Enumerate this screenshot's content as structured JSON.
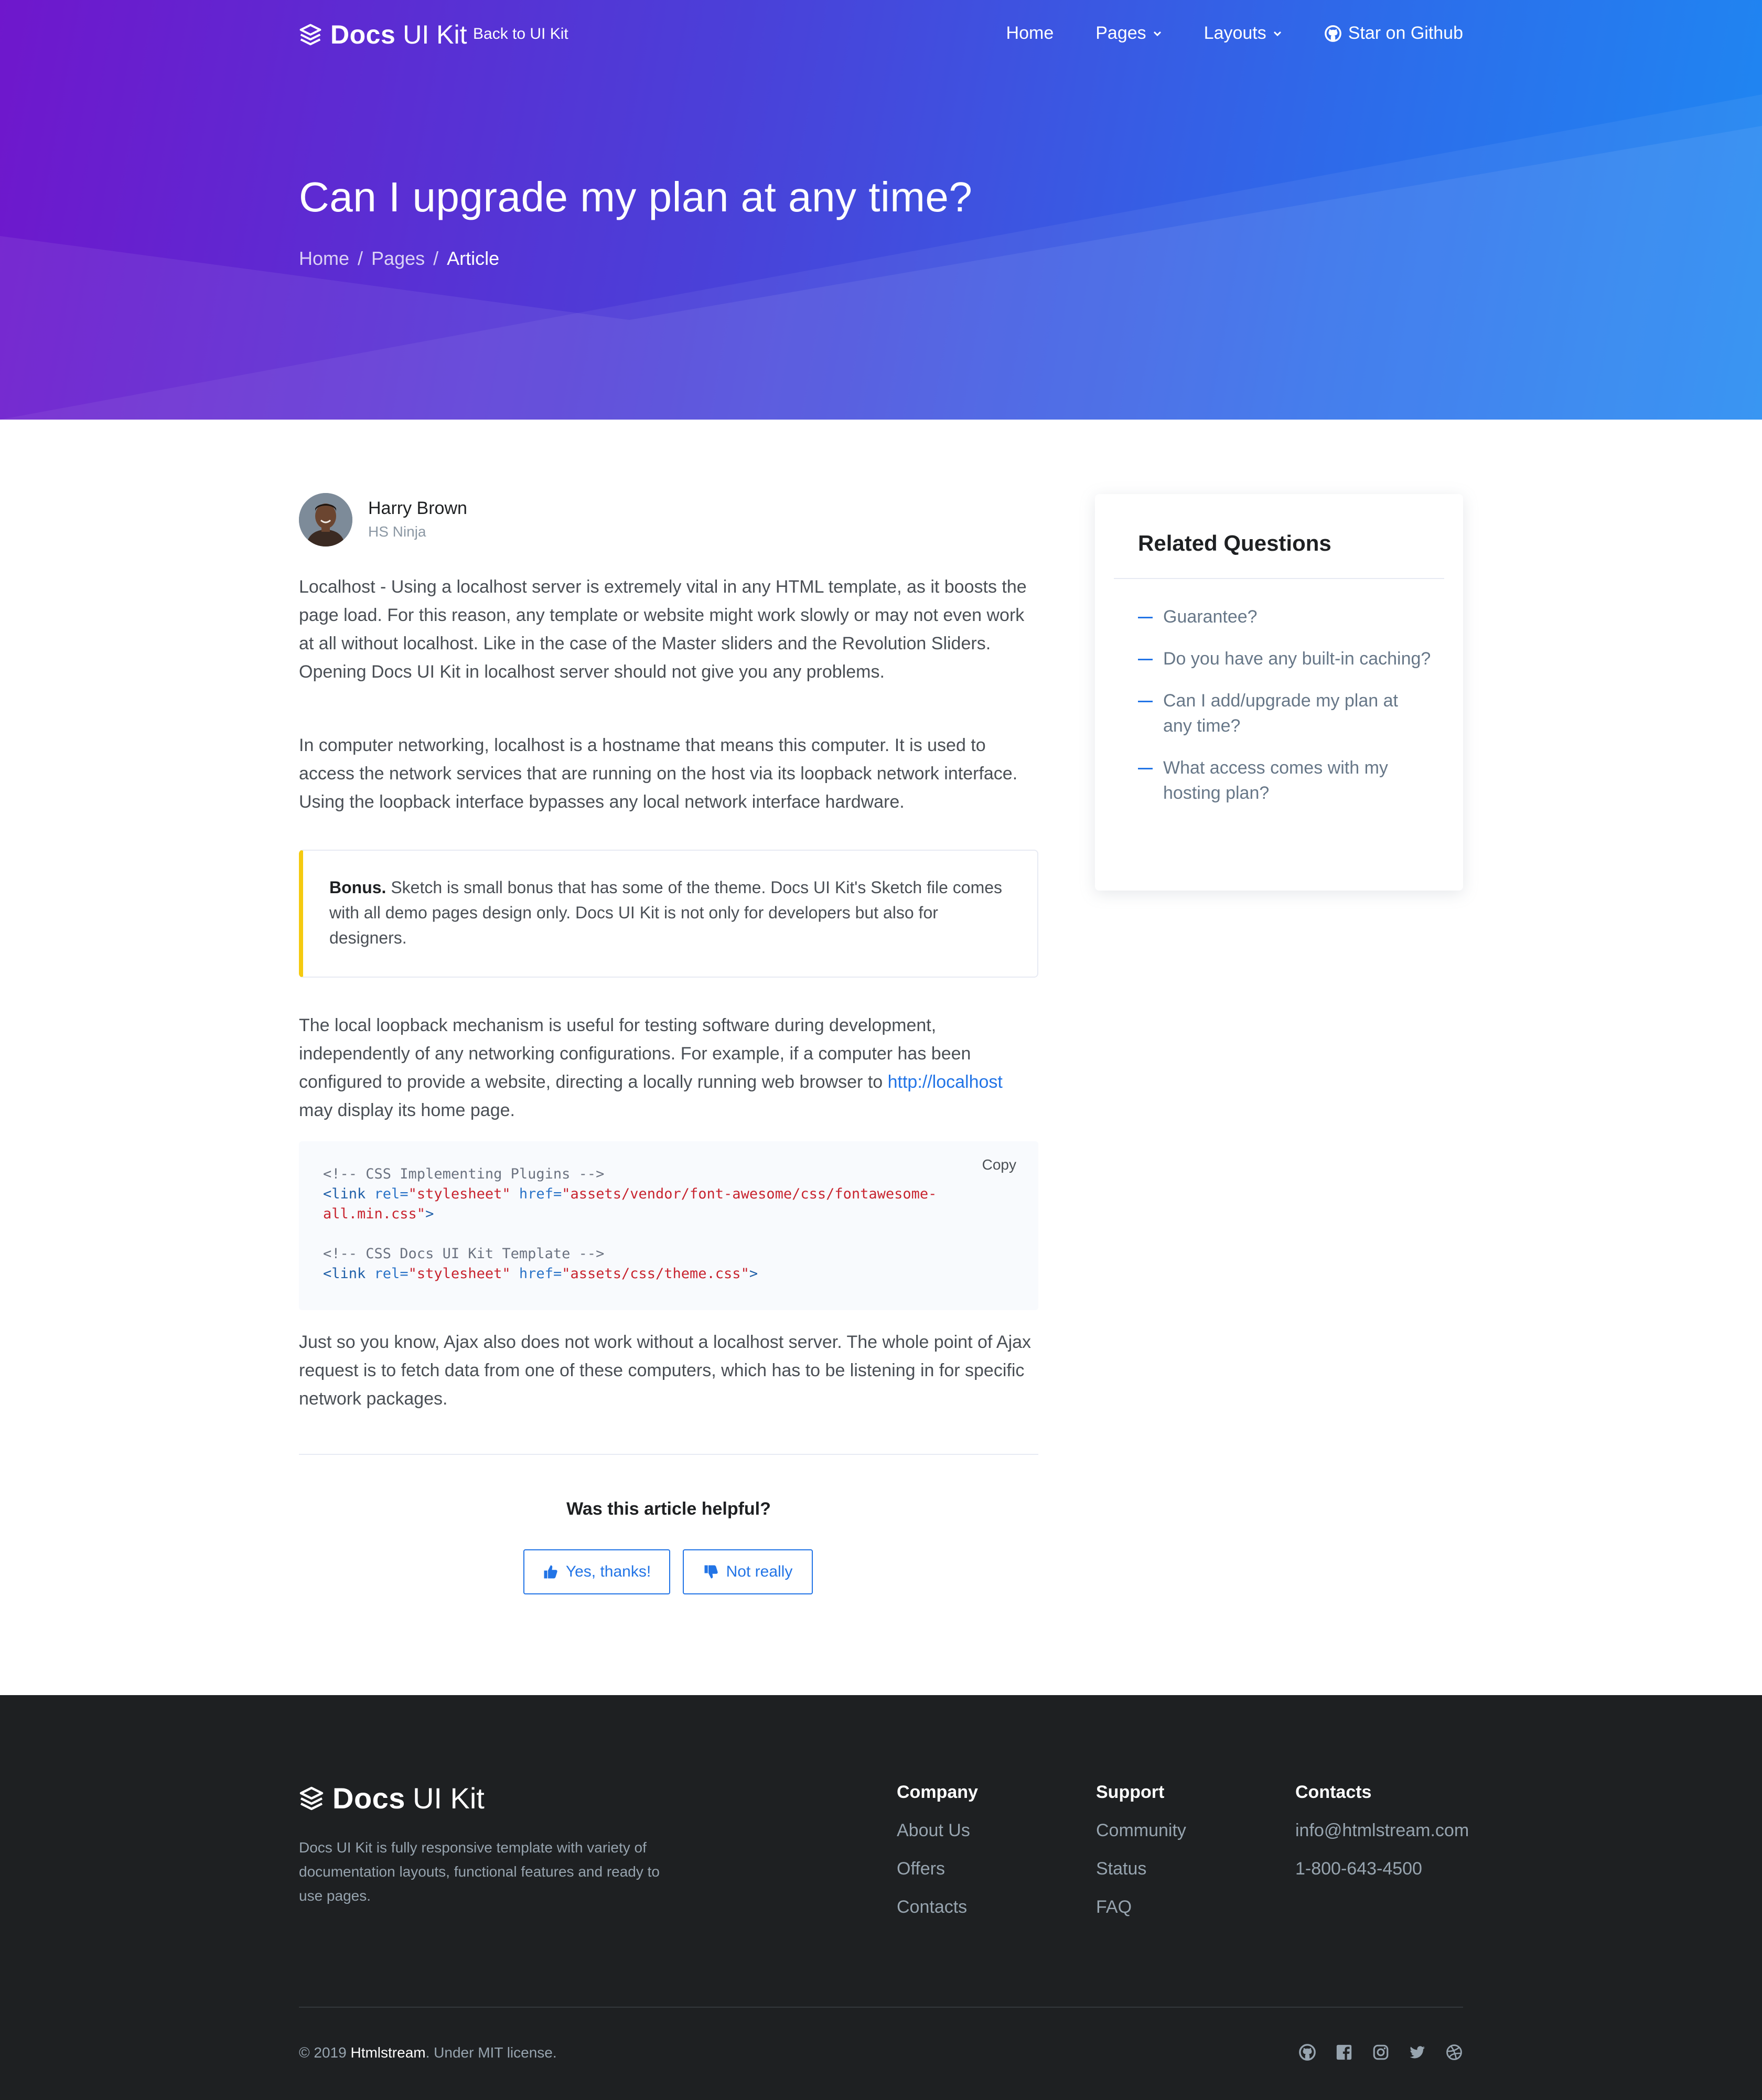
{
  "nav": {
    "brand_name": "Docs",
    "brand_suffix": "UI Kit",
    "back_link": "Back to UI Kit",
    "items": [
      {
        "label": "Home"
      },
      {
        "label": "Pages"
      },
      {
        "label": "Layouts"
      },
      {
        "label": "Star on Github"
      }
    ]
  },
  "hero": {
    "title": "Can I upgrade my plan at any time?",
    "breadcrumb": [
      "Home",
      "Pages",
      "Article"
    ],
    "separator": "/"
  },
  "author": {
    "name": "Harry Brown",
    "role": "HS Ninja"
  },
  "article": {
    "paragraph_1": "Localhost - Using a localhost server is extremely vital in any HTML template, as it boosts the page load. For this reason, any template or website might work slowly or may not even work at all without localhost. Like in the case of the Master sliders and the Revolution Sliders. Opening Docs UI Kit in localhost server should not give you any problems.",
    "paragraph_2": "In computer networking, localhost is a hostname that means this computer. It is used to access the network services that are running on the host via its loopback network interface. Using the loopback interface bypasses any local network interface hardware.",
    "callout_bold": "Bonus.",
    "callout_text": " Sketch is small bonus that has some of the theme. Docs UI Kit's Sketch file comes with all demo pages design only. Docs UI Kit is not only for developers but also for designers.",
    "paragraph_3": "The local loopback mechanism is useful for testing software during development, independently of any networking configurations. For example, if a computer has been configured to provide a website, directing a locally running web browser to ",
    "paragraph_3_link": "http://localhost",
    "paragraph_3_end": " may display its home page.",
    "code_copy": "Copy",
    "code": {
      "comment_1": "<!-- CSS Implementing Plugins -->",
      "comment_2": "<!-- CSS Docs UI Kit Template -->",
      "tag_open": "<link",
      "attr_rel": "rel=",
      "val_rel": "\"stylesheet\"",
      "attr_href": "href=",
      "val_href_1a": "\"assets/vendor/font-awesome/css/fontawesome-",
      "val_href_1b": "all.min.css\"",
      "val_href_2": "\"assets/css/theme.css\"",
      "tag_close": ">"
    },
    "paragraph_4": "Just so you know, Ajax also does not work without a localhost server. The whole point of Ajax request is to fetch data from one of these computers, which has to be listening in for specific network packages.",
    "helpful_question": "Was this article helpful?",
    "yes_label": "Yes, thanks!",
    "no_label": "Not really"
  },
  "sidebar": {
    "title": "Related Questions",
    "questions": [
      "Guarantee?",
      "Do you have any built-in caching?",
      "Can I add/upgrade my plan at any time?",
      "What access comes with my hosting plan?"
    ]
  },
  "footer": {
    "brand_name": "Docs",
    "brand_suffix": "UI Kit",
    "description": "Docs UI Kit is fully responsive template with variety of documentation layouts, functional features and ready to use pages.",
    "columns": [
      {
        "title": "Company",
        "links": [
          "About Us",
          "Offers",
          "Contacts"
        ]
      },
      {
        "title": "Support",
        "links": [
          "Community",
          "Status",
          "FAQ"
        ]
      },
      {
        "title": "Contacts",
        "links": [
          "info@htmlstream.com",
          "1-800-643-4500"
        ]
      }
    ],
    "copyright_prefix": "© 2019 ",
    "copyright_brand": "Htmlstream",
    "copyright_suffix": ". Under MIT license.",
    "socials": [
      "github-icon",
      "facebook-icon",
      "instagram-icon",
      "twitter-icon",
      "dribbble-icon"
    ]
  },
  "colors": {
    "accent": "#2274e6",
    "callout_border": "#f5ca0f",
    "footer_bg": "#1e2022",
    "hero_start": "#6f17cc",
    "hero_end": "#1e88f2"
  }
}
